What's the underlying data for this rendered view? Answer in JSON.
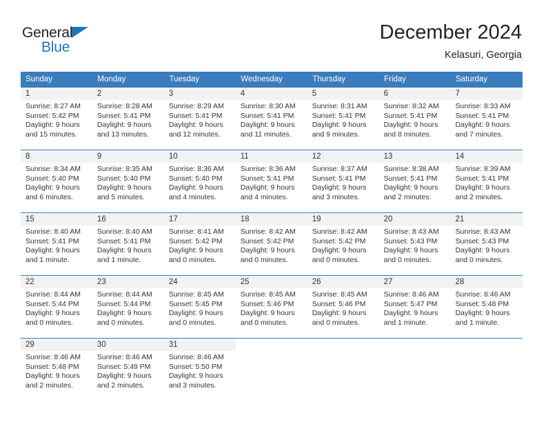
{
  "brand": {
    "name_part1": "General",
    "name_part2": "Blue",
    "accent_color": "#1b75bb"
  },
  "header": {
    "title": "December 2024",
    "subtitle": "Kelasuri, Georgia"
  },
  "calendar": {
    "header_bg": "#3b7cbd",
    "daynum_bg": "#f2f2f2",
    "weekdays": [
      "Sunday",
      "Monday",
      "Tuesday",
      "Wednesday",
      "Thursday",
      "Friday",
      "Saturday"
    ],
    "weeks": [
      [
        {
          "day": "1",
          "sunrise": "Sunrise: 8:27 AM",
          "sunset": "Sunset: 5:42 PM",
          "daylight1": "Daylight: 9 hours",
          "daylight2": "and 15 minutes."
        },
        {
          "day": "2",
          "sunrise": "Sunrise: 8:28 AM",
          "sunset": "Sunset: 5:41 PM",
          "daylight1": "Daylight: 9 hours",
          "daylight2": "and 13 minutes."
        },
        {
          "day": "3",
          "sunrise": "Sunrise: 8:29 AM",
          "sunset": "Sunset: 5:41 PM",
          "daylight1": "Daylight: 9 hours",
          "daylight2": "and 12 minutes."
        },
        {
          "day": "4",
          "sunrise": "Sunrise: 8:30 AM",
          "sunset": "Sunset: 5:41 PM",
          "daylight1": "Daylight: 9 hours",
          "daylight2": "and 11 minutes."
        },
        {
          "day": "5",
          "sunrise": "Sunrise: 8:31 AM",
          "sunset": "Sunset: 5:41 PM",
          "daylight1": "Daylight: 9 hours",
          "daylight2": "and 9 minutes."
        },
        {
          "day": "6",
          "sunrise": "Sunrise: 8:32 AM",
          "sunset": "Sunset: 5:41 PM",
          "daylight1": "Daylight: 9 hours",
          "daylight2": "and 8 minutes."
        },
        {
          "day": "7",
          "sunrise": "Sunrise: 8:33 AM",
          "sunset": "Sunset: 5:41 PM",
          "daylight1": "Daylight: 9 hours",
          "daylight2": "and 7 minutes."
        }
      ],
      [
        {
          "day": "8",
          "sunrise": "Sunrise: 8:34 AM",
          "sunset": "Sunset: 5:40 PM",
          "daylight1": "Daylight: 9 hours",
          "daylight2": "and 6 minutes."
        },
        {
          "day": "9",
          "sunrise": "Sunrise: 8:35 AM",
          "sunset": "Sunset: 5:40 PM",
          "daylight1": "Daylight: 9 hours",
          "daylight2": "and 5 minutes."
        },
        {
          "day": "10",
          "sunrise": "Sunrise: 8:36 AM",
          "sunset": "Sunset: 5:40 PM",
          "daylight1": "Daylight: 9 hours",
          "daylight2": "and 4 minutes."
        },
        {
          "day": "11",
          "sunrise": "Sunrise: 8:36 AM",
          "sunset": "Sunset: 5:41 PM",
          "daylight1": "Daylight: 9 hours",
          "daylight2": "and 4 minutes."
        },
        {
          "day": "12",
          "sunrise": "Sunrise: 8:37 AM",
          "sunset": "Sunset: 5:41 PM",
          "daylight1": "Daylight: 9 hours",
          "daylight2": "and 3 minutes."
        },
        {
          "day": "13",
          "sunrise": "Sunrise: 8:38 AM",
          "sunset": "Sunset: 5:41 PM",
          "daylight1": "Daylight: 9 hours",
          "daylight2": "and 2 minutes."
        },
        {
          "day": "14",
          "sunrise": "Sunrise: 8:39 AM",
          "sunset": "Sunset: 5:41 PM",
          "daylight1": "Daylight: 9 hours",
          "daylight2": "and 2 minutes."
        }
      ],
      [
        {
          "day": "15",
          "sunrise": "Sunrise: 8:40 AM",
          "sunset": "Sunset: 5:41 PM",
          "daylight1": "Daylight: 9 hours",
          "daylight2": "and 1 minute."
        },
        {
          "day": "16",
          "sunrise": "Sunrise: 8:40 AM",
          "sunset": "Sunset: 5:41 PM",
          "daylight1": "Daylight: 9 hours",
          "daylight2": "and 1 minute."
        },
        {
          "day": "17",
          "sunrise": "Sunrise: 8:41 AM",
          "sunset": "Sunset: 5:42 PM",
          "daylight1": "Daylight: 9 hours",
          "daylight2": "and 0 minutes."
        },
        {
          "day": "18",
          "sunrise": "Sunrise: 8:42 AM",
          "sunset": "Sunset: 5:42 PM",
          "daylight1": "Daylight: 9 hours",
          "daylight2": "and 0 minutes."
        },
        {
          "day": "19",
          "sunrise": "Sunrise: 8:42 AM",
          "sunset": "Sunset: 5:42 PM",
          "daylight1": "Daylight: 9 hours",
          "daylight2": "and 0 minutes."
        },
        {
          "day": "20",
          "sunrise": "Sunrise: 8:43 AM",
          "sunset": "Sunset: 5:43 PM",
          "daylight1": "Daylight: 9 hours",
          "daylight2": "and 0 minutes."
        },
        {
          "day": "21",
          "sunrise": "Sunrise: 8:43 AM",
          "sunset": "Sunset: 5:43 PM",
          "daylight1": "Daylight: 9 hours",
          "daylight2": "and 0 minutes."
        }
      ],
      [
        {
          "day": "22",
          "sunrise": "Sunrise: 8:44 AM",
          "sunset": "Sunset: 5:44 PM",
          "daylight1": "Daylight: 9 hours",
          "daylight2": "and 0 minutes."
        },
        {
          "day": "23",
          "sunrise": "Sunrise: 8:44 AM",
          "sunset": "Sunset: 5:44 PM",
          "daylight1": "Daylight: 9 hours",
          "daylight2": "and 0 minutes."
        },
        {
          "day": "24",
          "sunrise": "Sunrise: 8:45 AM",
          "sunset": "Sunset: 5:45 PM",
          "daylight1": "Daylight: 9 hours",
          "daylight2": "and 0 minutes."
        },
        {
          "day": "25",
          "sunrise": "Sunrise: 8:45 AM",
          "sunset": "Sunset: 5:46 PM",
          "daylight1": "Daylight: 9 hours",
          "daylight2": "and 0 minutes."
        },
        {
          "day": "26",
          "sunrise": "Sunrise: 8:45 AM",
          "sunset": "Sunset: 5:46 PM",
          "daylight1": "Daylight: 9 hours",
          "daylight2": "and 0 minutes."
        },
        {
          "day": "27",
          "sunrise": "Sunrise: 8:46 AM",
          "sunset": "Sunset: 5:47 PM",
          "daylight1": "Daylight: 9 hours",
          "daylight2": "and 1 minute."
        },
        {
          "day": "28",
          "sunrise": "Sunrise: 8:46 AM",
          "sunset": "Sunset: 5:48 PM",
          "daylight1": "Daylight: 9 hours",
          "daylight2": "and 1 minute."
        }
      ],
      [
        {
          "day": "29",
          "sunrise": "Sunrise: 8:46 AM",
          "sunset": "Sunset: 5:48 PM",
          "daylight1": "Daylight: 9 hours",
          "daylight2": "and 2 minutes."
        },
        {
          "day": "30",
          "sunrise": "Sunrise: 8:46 AM",
          "sunset": "Sunset: 5:49 PM",
          "daylight1": "Daylight: 9 hours",
          "daylight2": "and 2 minutes."
        },
        {
          "day": "31",
          "sunrise": "Sunrise: 8:46 AM",
          "sunset": "Sunset: 5:50 PM",
          "daylight1": "Daylight: 9 hours",
          "daylight2": "and 3 minutes."
        },
        {
          "day": "",
          "sunrise": "",
          "sunset": "",
          "daylight1": "",
          "daylight2": ""
        },
        {
          "day": "",
          "sunrise": "",
          "sunset": "",
          "daylight1": "",
          "daylight2": ""
        },
        {
          "day": "",
          "sunrise": "",
          "sunset": "",
          "daylight1": "",
          "daylight2": ""
        },
        {
          "day": "",
          "sunrise": "",
          "sunset": "",
          "daylight1": "",
          "daylight2": ""
        }
      ]
    ]
  }
}
